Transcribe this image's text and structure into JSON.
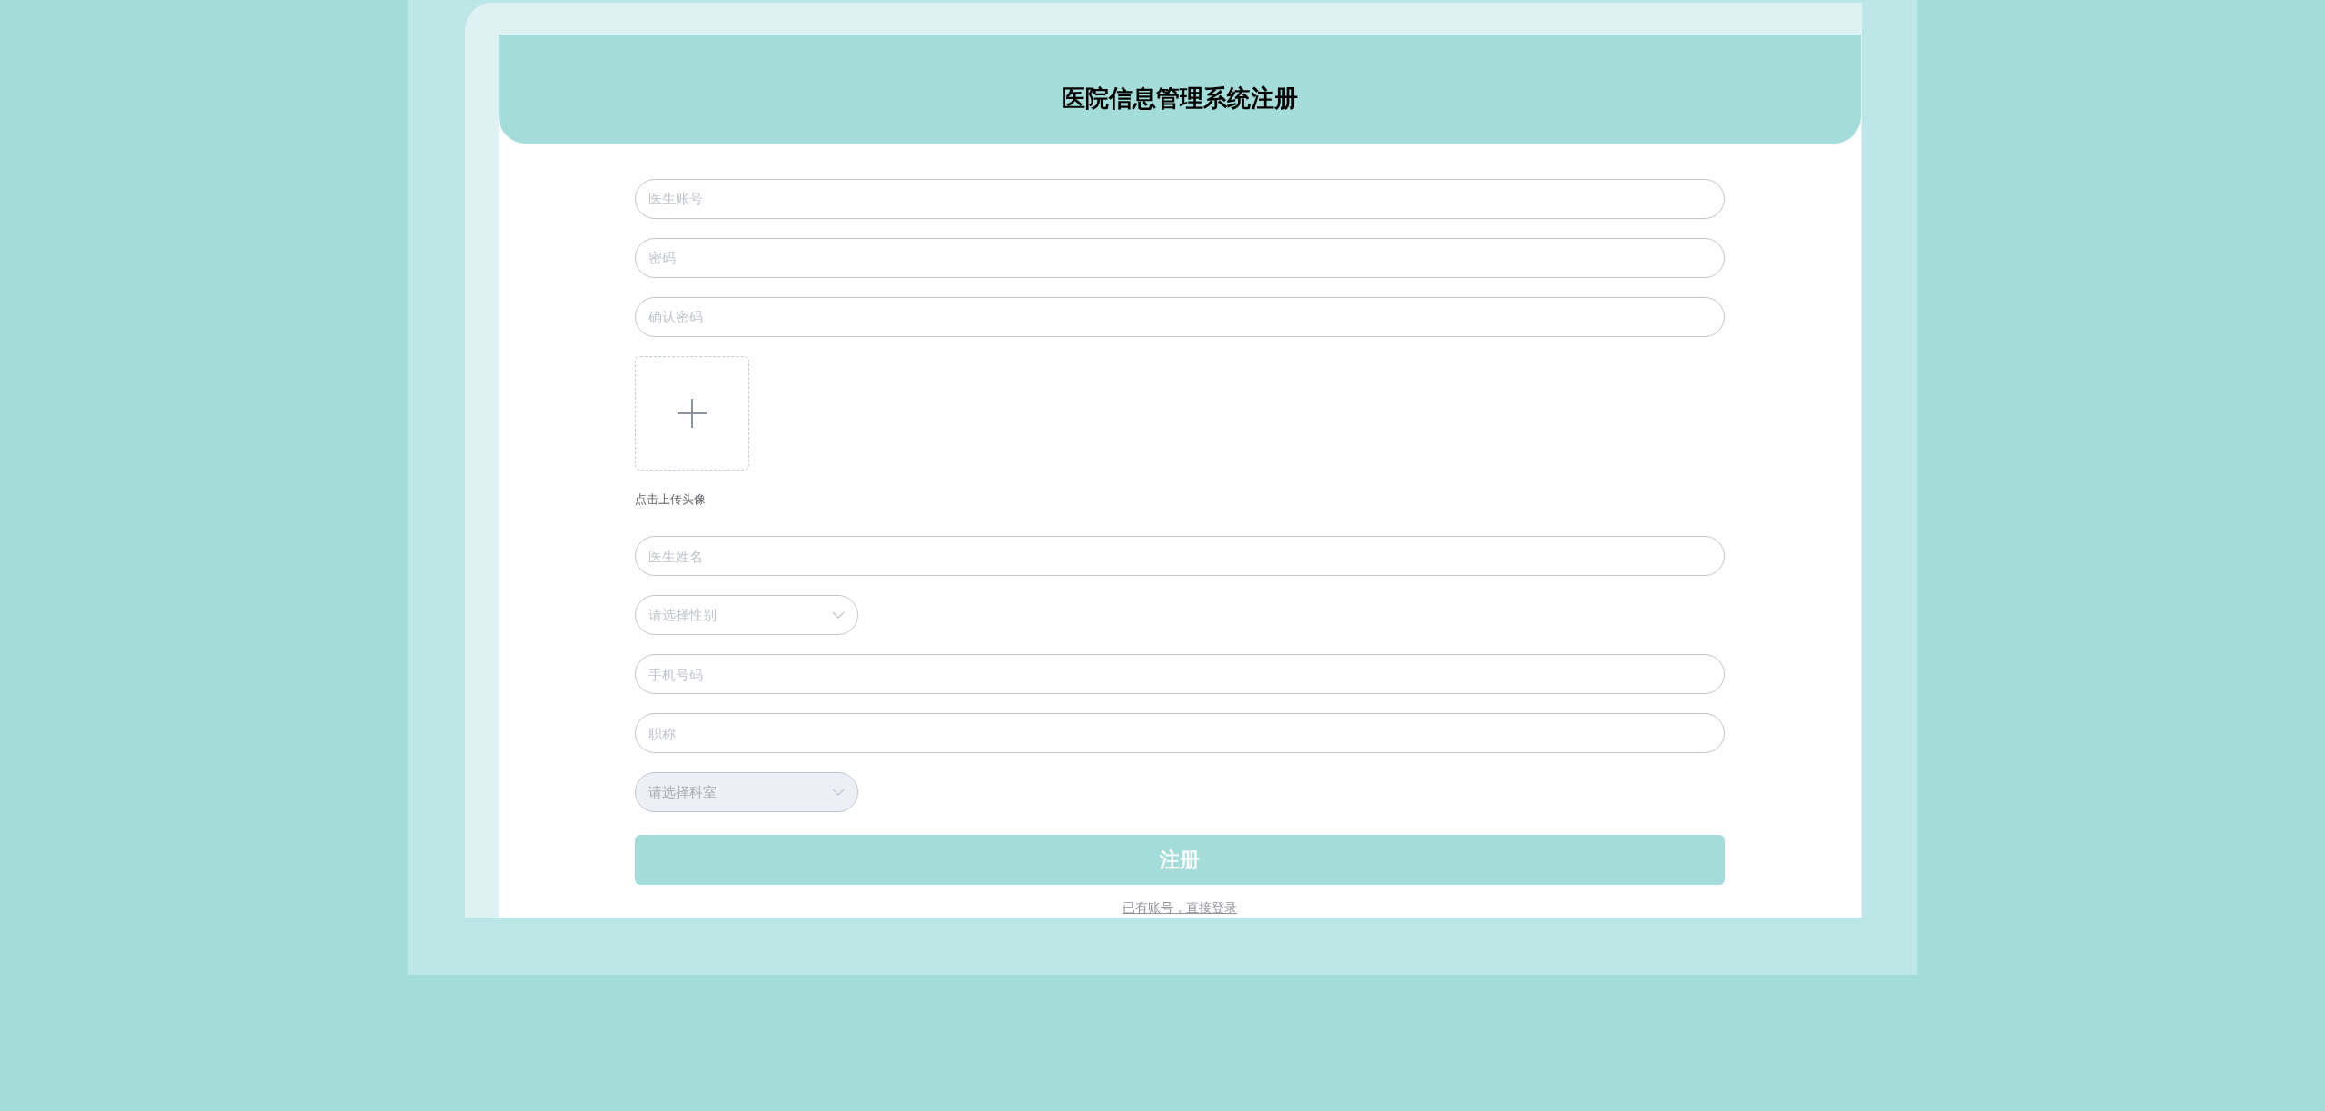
{
  "title": "医院信息管理系统注册",
  "fields": [
    {
      "kind": "input",
      "placeholder": "医生账号"
    },
    {
      "kind": "input",
      "placeholder": "密码"
    },
    {
      "kind": "input",
      "placeholder": "确认密码"
    },
    {
      "kind": "upload",
      "label": "点击上传头像"
    },
    {
      "kind": "input",
      "placeholder": "医生姓名"
    },
    {
      "kind": "select",
      "placeholder": "请选择性别",
      "disabled": false
    },
    {
      "kind": "input",
      "placeholder": "手机号码"
    },
    {
      "kind": "input",
      "placeholder": "职称"
    },
    {
      "kind": "select",
      "placeholder": "请选择科室",
      "disabled": true
    }
  ],
  "submit": "注册",
  "login_link": "已有账号，直接登录"
}
